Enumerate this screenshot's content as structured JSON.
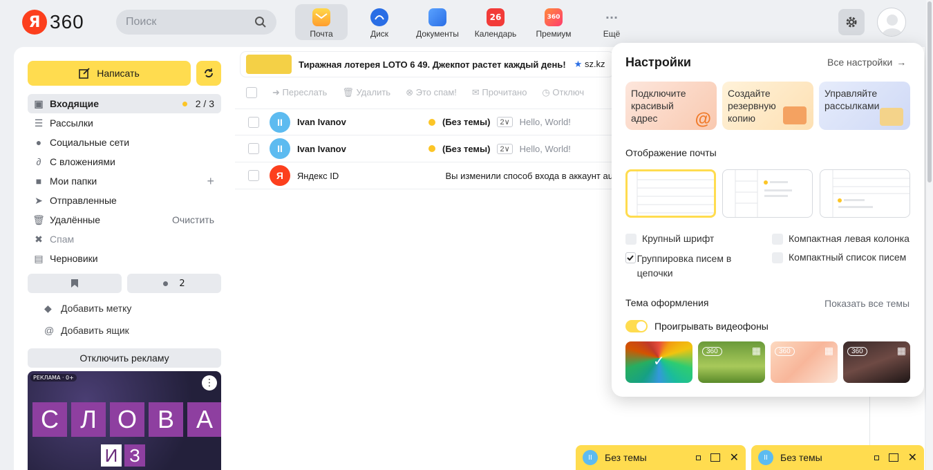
{
  "brand": {
    "ya": "Я",
    "name": "360"
  },
  "search": {
    "placeholder": "Поиск"
  },
  "apps": [
    {
      "label": "Почта",
      "color": "#ffcc00"
    },
    {
      "label": "Диск",
      "color": "#2a6ee5"
    },
    {
      "label": "Документы",
      "color": "#3d8bf5"
    },
    {
      "label": "Календарь",
      "badge": "26",
      "color": "#f23b38"
    },
    {
      "label": "Премиум",
      "badge": "360",
      "color": "#ff5a3c"
    },
    {
      "label": "Ещё",
      "icon": "dots-icon"
    }
  ],
  "compose": {
    "label": "Написать"
  },
  "folders": [
    {
      "label": "Входящие",
      "count": "2 / 3",
      "icon": "inbox-icon"
    },
    {
      "label": "Рассылки",
      "icon": "newsletter-icon"
    },
    {
      "label": "Социальные сети",
      "icon": "chat-icon"
    },
    {
      "label": "С вложениями",
      "icon": "paperclip-icon"
    },
    {
      "label": "Мои папки",
      "icon": "folder-icon",
      "action": "+"
    },
    {
      "label": "Отправленные",
      "icon": "send-icon"
    },
    {
      "label": "Удалённые",
      "icon": "trash-icon",
      "action": "Очистить"
    },
    {
      "label": "Спам",
      "icon": "spam-icon"
    },
    {
      "label": "Черновики",
      "icon": "drafts-icon"
    }
  ],
  "unread_count": "2",
  "extras": {
    "add_label": "Добавить метку",
    "add_box": "Добавить ящик"
  },
  "no_ads": "Отключить рекламу",
  "side_ad": {
    "tag": "РЕКЛАМА · 0+",
    "word1": [
      "С",
      "Л",
      "О",
      "В",
      "А"
    ],
    "word2": [
      "И",
      "З"
    ]
  },
  "top_ad": {
    "text": "Тиражная лотерея LOTO 6 49. Джекпот растет каждый день!",
    "source": "sz.kz"
  },
  "toolbar": [
    "Переслать",
    "Удалить",
    "Это спам!",
    "Прочитано",
    "Отключ"
  ],
  "messages": [
    {
      "from": "Ivan Ivanov",
      "subject": "(Без темы)",
      "count": "2",
      "snippet": "Hello, World!",
      "avatar": "II",
      "avatar_color": "#5dbbf0"
    },
    {
      "from": "Ivan Ivanov",
      "subject": "(Без темы)",
      "count": "2",
      "snippet": "Hello, World!",
      "avatar": "II",
      "avatar_color": "#5dbbf0"
    },
    {
      "from": "Яндекс ID",
      "subject": "Вы изменили способ входа в аккаунт aut",
      "snippet": "",
      "avatar": "Я",
      "avatar_color": "#fc3f1d"
    }
  ],
  "settings": {
    "title": "Настройки",
    "all_link": "Все настройки",
    "promos": [
      "Подключите красивый адрес",
      "Создайте резервную копию",
      "Управляйте рассылками"
    ],
    "display_title": "Отображение почты",
    "options": {
      "large_font": "Крупный шрифт",
      "compact_left": "Компактная левая колонка",
      "threads": "Группировка писем в цепочки",
      "compact_list": "Компактный список писем"
    },
    "theme_title": "Тема оформления",
    "show_all_themes": "Показать все темы",
    "video_bg": "Проигрывать видеофоны",
    "theme_badge": "360"
  },
  "drafts": [
    {
      "subject": "Без темы",
      "avatar": "II"
    },
    {
      "subject": "Без темы",
      "avatar": "II"
    }
  ]
}
